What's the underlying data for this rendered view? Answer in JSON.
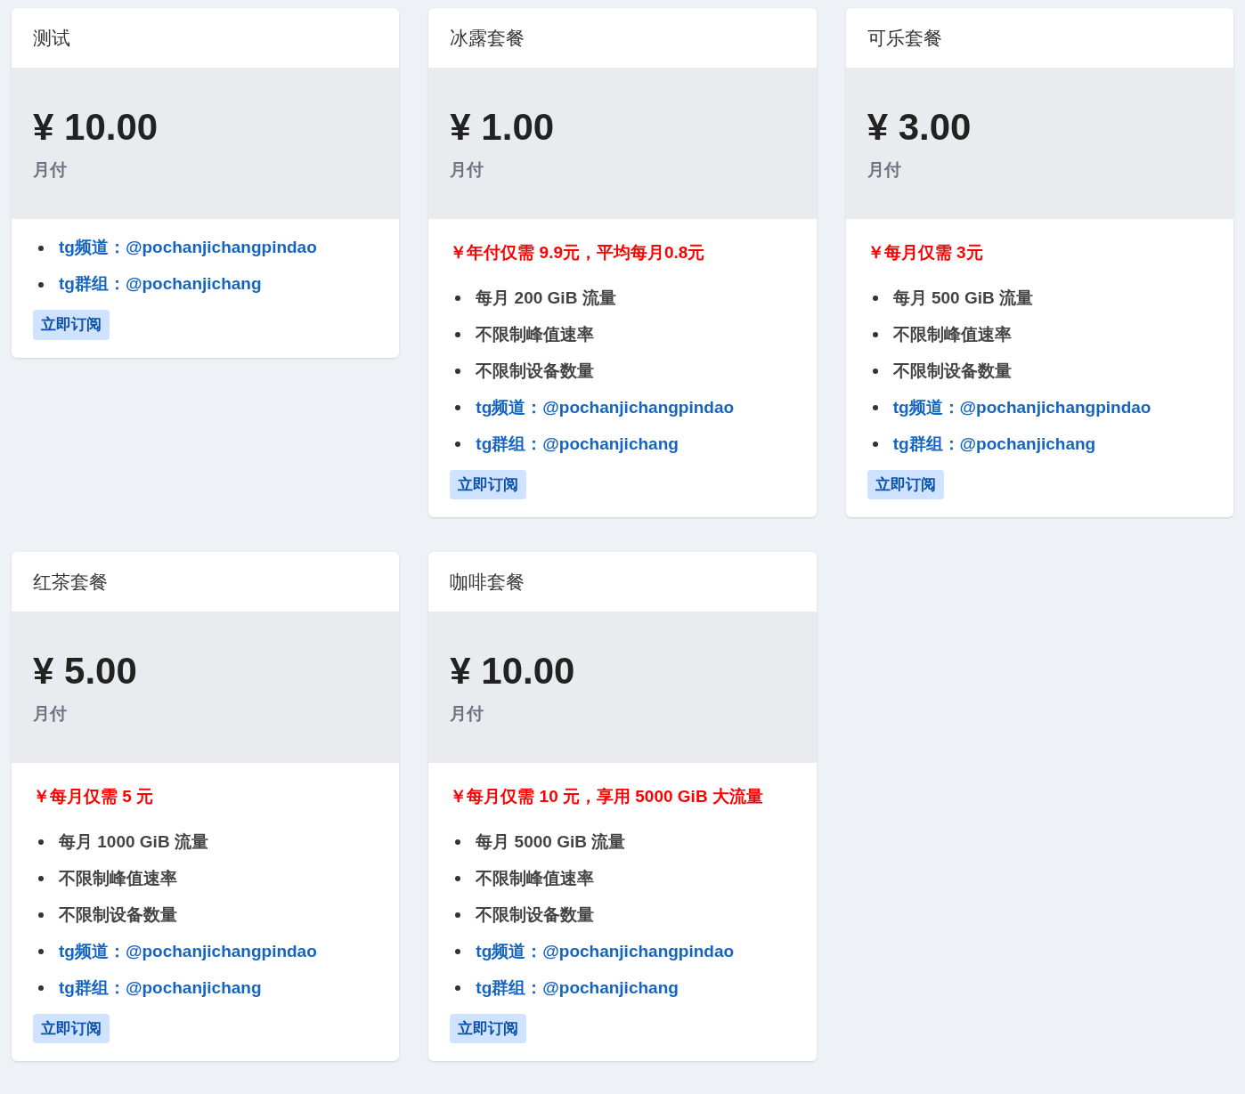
{
  "plans": [
    {
      "title": "测试",
      "price": "¥ 10.00",
      "period": "月付",
      "features": [
        {
          "kind": "link",
          "text": "tg频道：@pochanjichangpindao"
        },
        {
          "kind": "link",
          "text": "tg群组：@pochanjichang"
        }
      ],
      "button": "立即订阅"
    },
    {
      "title": "冰露套餐",
      "price": "¥ 1.00",
      "period": "月付",
      "promo": "￥年付仅需 9.9元，平均每月0.8元",
      "features": [
        {
          "kind": "text",
          "text": "每月 200 GiB 流量"
        },
        {
          "kind": "text",
          "text": "不限制峰值速率"
        },
        {
          "kind": "text",
          "text": "不限制设备数量"
        },
        {
          "kind": "link",
          "text": "tg频道：@pochanjichangpindao"
        },
        {
          "kind": "link",
          "text": "tg群组：@pochanjichang"
        }
      ],
      "button": "立即订阅"
    },
    {
      "title": "可乐套餐",
      "price": "¥ 3.00",
      "period": "月付",
      "promo": "￥每月仅需 3元",
      "features": [
        {
          "kind": "text",
          "text": "每月 500 GiB 流量"
        },
        {
          "kind": "text",
          "text": "不限制峰值速率"
        },
        {
          "kind": "text",
          "text": "不限制设备数量"
        },
        {
          "kind": "link",
          "text": "tg频道：@pochanjichangpindao"
        },
        {
          "kind": "link",
          "text": "tg群组：@pochanjichang"
        }
      ],
      "button": "立即订阅"
    },
    {
      "title": "红茶套餐",
      "price": "¥ 5.00",
      "period": "月付",
      "promo": "￥每月仅需 5 元",
      "features": [
        {
          "kind": "text",
          "text": "每月 1000 GiB 流量"
        },
        {
          "kind": "text",
          "text": "不限制峰值速率"
        },
        {
          "kind": "text",
          "text": "不限制设备数量"
        },
        {
          "kind": "link",
          "text": "tg频道：@pochanjichangpindao"
        },
        {
          "kind": "link",
          "text": "tg群组：@pochanjichang"
        }
      ],
      "button": "立即订阅"
    },
    {
      "title": "咖啡套餐",
      "price": "¥ 10.00",
      "period": "月付",
      "promo": "￥每月仅需 10 元，享用 5000 GiB 大流量",
      "features": [
        {
          "kind": "text",
          "text": "每月 5000 GiB 流量"
        },
        {
          "kind": "text",
          "text": "不限制峰值速率"
        },
        {
          "kind": "text",
          "text": "不限制设备数量"
        },
        {
          "kind": "link",
          "text": "tg频道：@pochanjichangpindao"
        },
        {
          "kind": "link",
          "text": "tg群组：@pochanjichang"
        }
      ],
      "button": "立即订阅"
    }
  ]
}
